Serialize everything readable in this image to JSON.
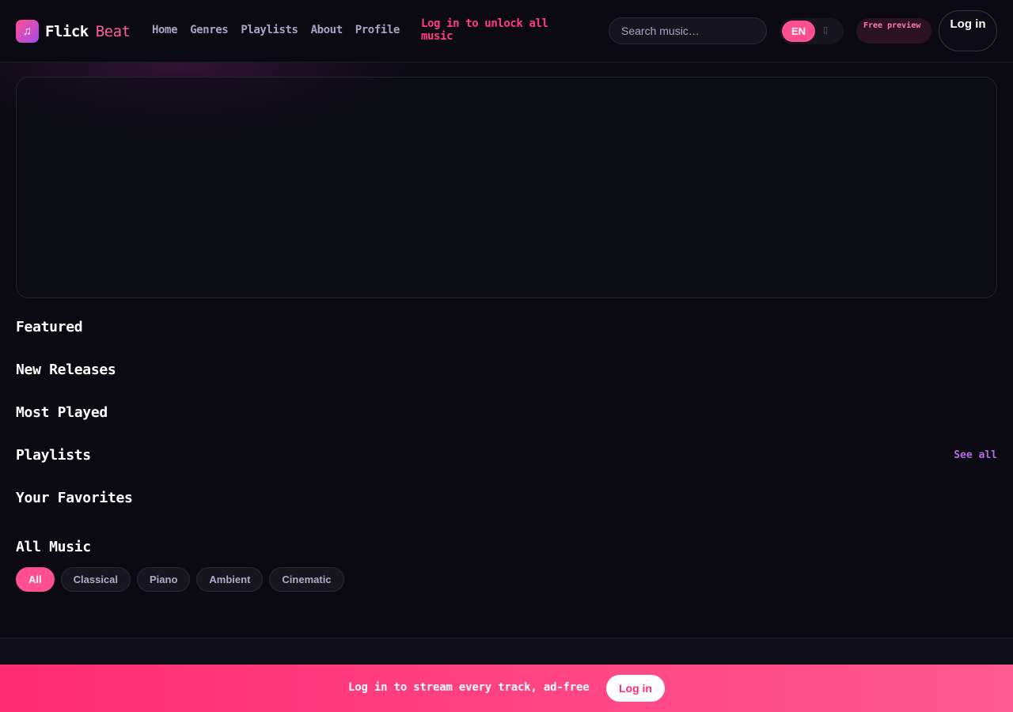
{
  "brand": {
    "name_part1": "Flick",
    "name_part2": "Beat",
    "logo_icon": "music-note-icon",
    "accent": "#ff4f8f"
  },
  "nav": {
    "items": [
      "Home",
      "Genres",
      "Playlists",
      "About",
      "Profile"
    ],
    "unlock_text": "Log in to unlock all music"
  },
  "search": {
    "placeholder": "Search music…"
  },
  "language": {
    "selected": "EN",
    "other_icon": "moon-icon"
  },
  "badge": {
    "preview": "Free preview"
  },
  "header_login": "Log in",
  "sections": {
    "featured": "Featured",
    "new_releases": "New Releases",
    "most_played": "Most Played",
    "playlists": "Playlists",
    "see_all": "See all",
    "favorites": "Your Favorites",
    "all_music": "All Music"
  },
  "filters": {
    "chips": [
      "All",
      "Classical",
      "Piano",
      "Ambient",
      "Cinematic"
    ],
    "active": "All"
  },
  "cta_bar": {
    "text": "Log in to stream every track, ad-free",
    "button": "Log in"
  }
}
